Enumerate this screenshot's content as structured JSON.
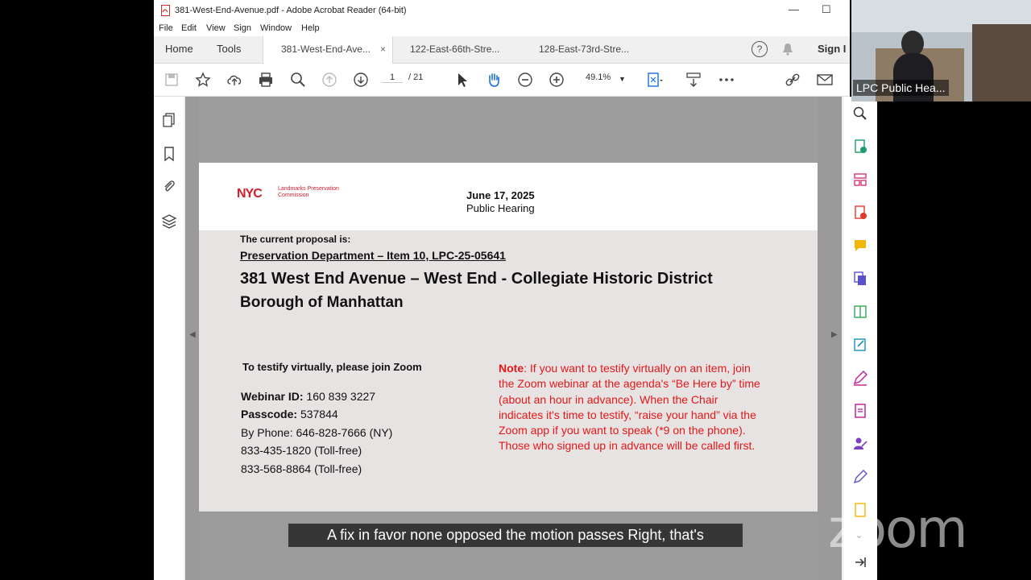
{
  "window": {
    "title": "381-West-End-Avenue.pdf - Adobe Acrobat Reader (64-bit)",
    "minimize": "—",
    "maximize": "☐"
  },
  "menu": [
    "File",
    "Edit",
    "View",
    "Sign",
    "Window",
    "Help"
  ],
  "tabs": {
    "home": "Home",
    "tools": "Tools",
    "docs": [
      {
        "label": "381-West-End-Ave...",
        "close": "×"
      },
      {
        "label": "122-East-66th-Stre..."
      },
      {
        "label": "128-East-73rd-Stre..."
      }
    ],
    "sign_in": "Sign I",
    "help": "?"
  },
  "toolbar": {
    "page_current": "1",
    "page_total": "/ 21",
    "zoom": "49.1%"
  },
  "document": {
    "nyc": "NYC",
    "lpc_line1": "Landmarks Preservation",
    "lpc_line2": "Commission",
    "date": "June 17, 2025",
    "hearing": "Public Hearing",
    "proposal": "The current proposal is:",
    "department": "Preservation Department – Item 10, LPC-25-05641",
    "heading1": "381 West End Avenue – West End - Collegiate Historic District",
    "heading2": "Borough of Manhattan",
    "testify": "To testify virtually, please join Zoom",
    "webinar_label": "Webinar ID:",
    "webinar_value": "160 839 3227",
    "passcode_label": "Passcode:",
    "passcode_value": "537844",
    "phone1": "By Phone: 646-828-7666 (NY)",
    "phone2": "833-435-1820 (Toll-free)",
    "phone3": "833-568-8864 (Toll-free)",
    "note_label": "Note",
    "note_text": ": If you want to testify virtually on an item, join the Zoom webinar at the agenda's “Be Here by” time (about an hour in advance). When the Chair indicates it's time to testify, “raise your hand” via the Zoom app if you want to speak (*9 on the phone). Those who signed up in advance will be called first."
  },
  "video": {
    "label": "LPC Public Hea..."
  },
  "caption": "A fix in favor none opposed the motion passes Right, that's",
  "zoom_logo": "zoom",
  "colors": {
    "accent_red": "#e31818",
    "nyc_red": "#d01f2e"
  }
}
